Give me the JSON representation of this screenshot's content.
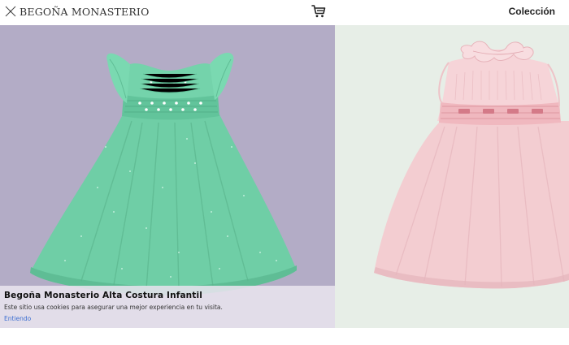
{
  "header": {
    "brand": "Begoña Monasterio",
    "brand_display": "BEGOÑA MONASTERIO",
    "nav_collection": "Colección",
    "cart_icon": "shopping-cart-icon",
    "logo_icon": "needle-cross-icon"
  },
  "gallery": {
    "slides": [
      {
        "subject": "mint-green-smocked-dress",
        "background": "#b3acc6"
      },
      {
        "subject": "pink-smocked-dress-ruffle-collar",
        "background": "#e7eee7"
      }
    ]
  },
  "cookie_banner": {
    "title": "Begoña Monasterio Alta Costura Infantil",
    "message": "Este sitio usa cookies para asegurar una mejor experiencia en tu visita.",
    "accept_label": "Entiendo"
  },
  "colors": {
    "link": "#3d6fd1",
    "green_dress": "#6fcea6",
    "pink_dress": "#f3cdd1"
  }
}
